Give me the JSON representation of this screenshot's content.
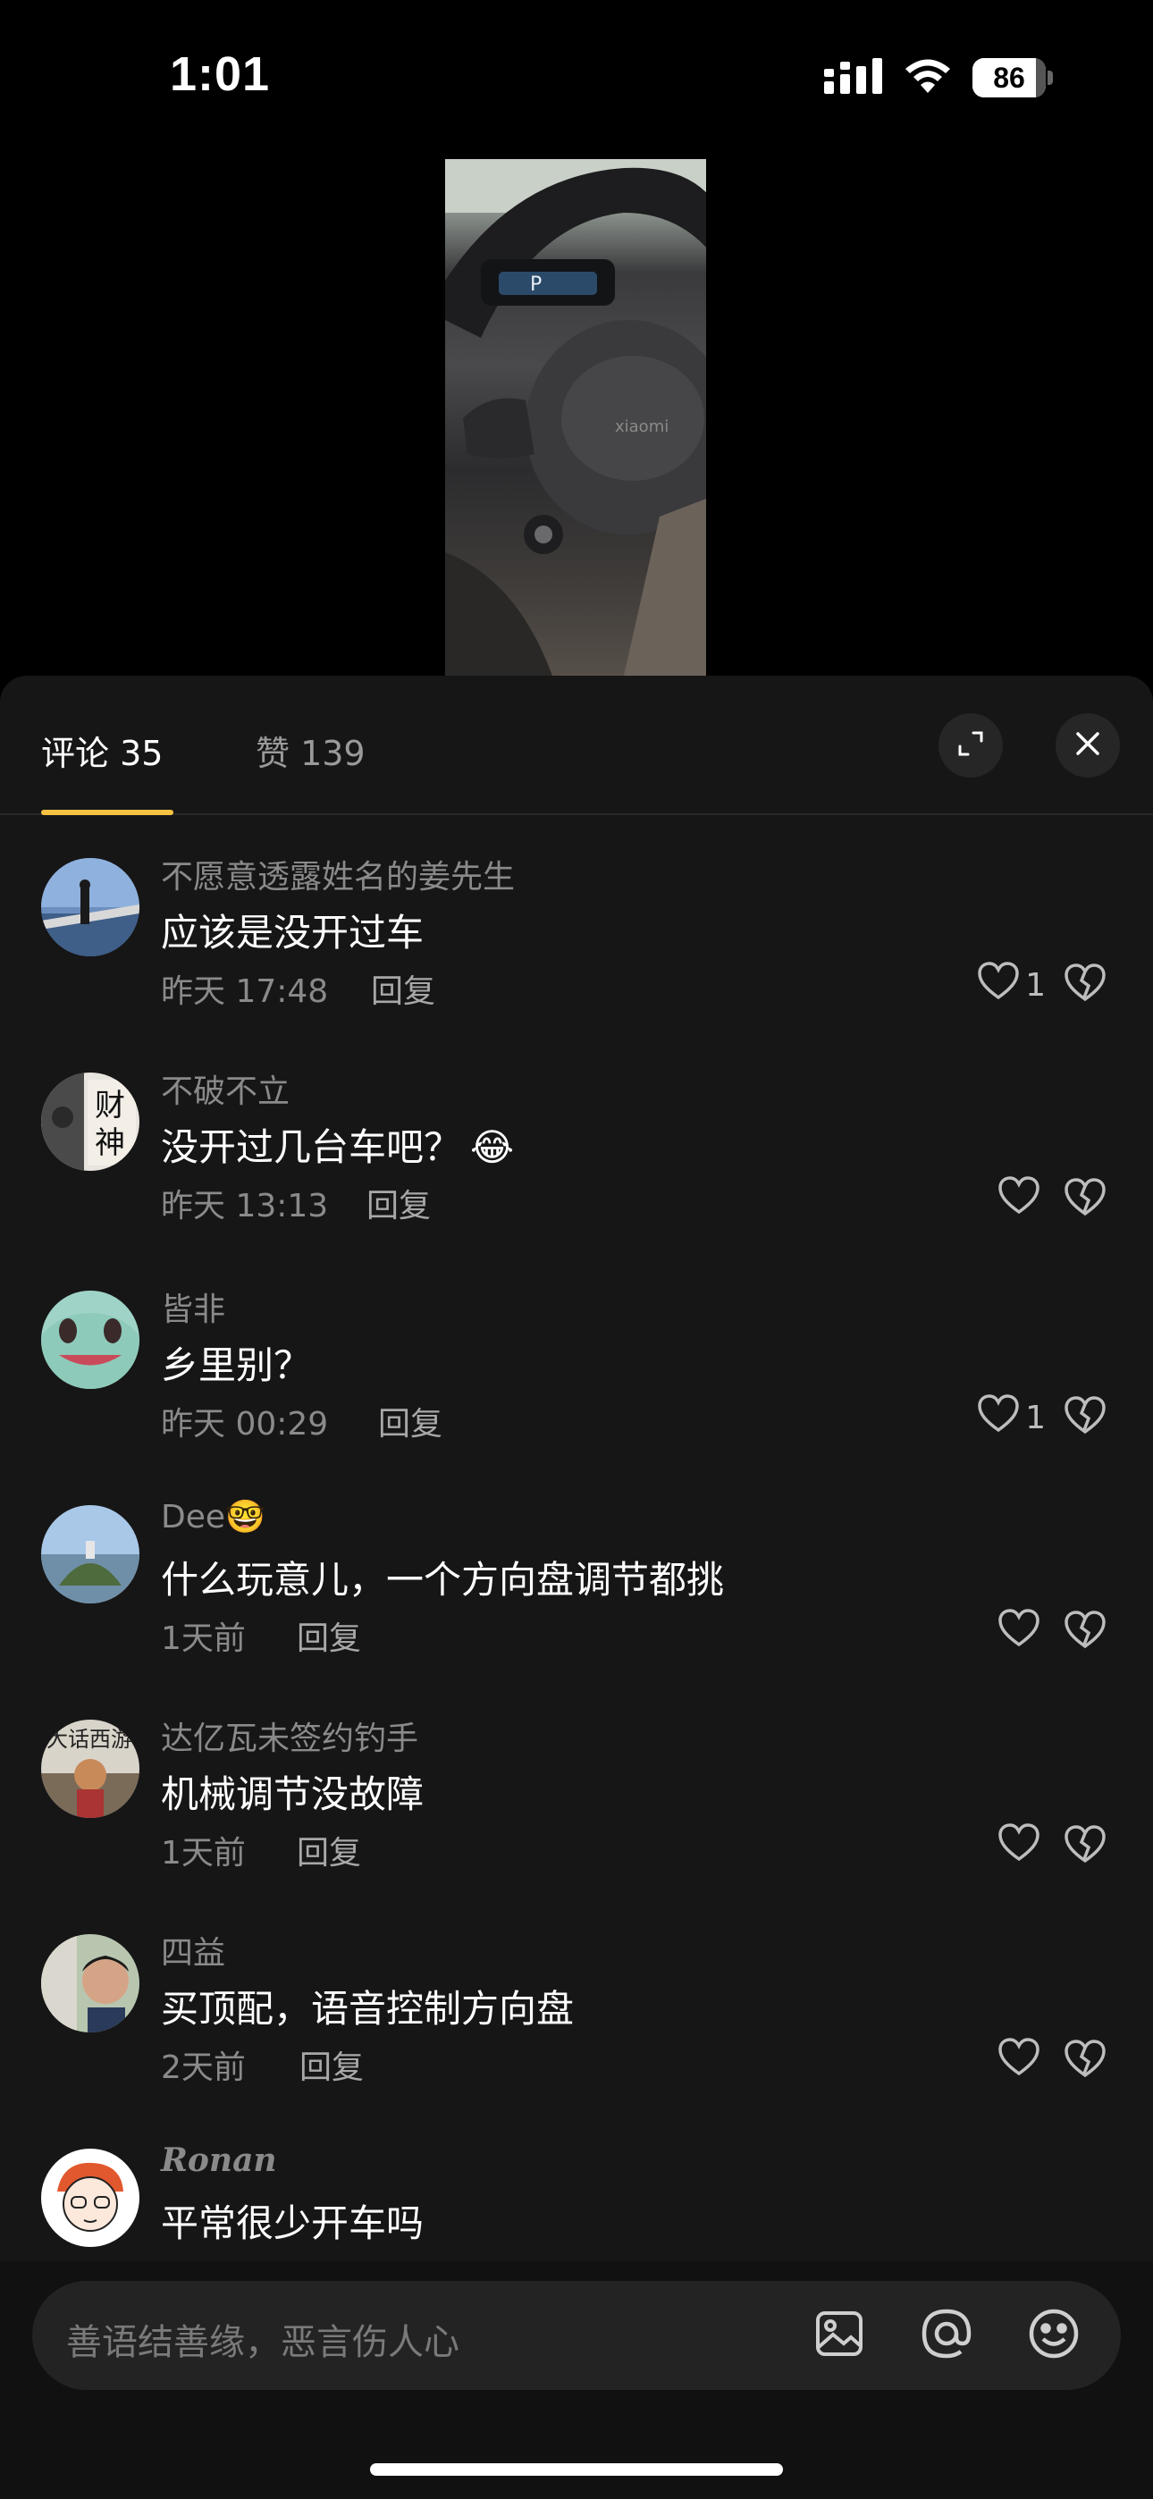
{
  "status_bar": {
    "time": "1:01",
    "battery_level": "86",
    "battery_fraction": 0.86,
    "icons": [
      "cellular-signal-icon",
      "wifi-icon",
      "battery-icon"
    ]
  },
  "video": {
    "description_icon": "video-thumbnail"
  },
  "sheet": {
    "tabs": [
      {
        "label": "评论 35",
        "active": true
      },
      {
        "label": "赞 139",
        "active": false
      }
    ],
    "accent": "#f6c342",
    "buttons": [
      "expand-icon",
      "close-icon"
    ]
  },
  "comments": [
    {
      "name": "不愿意透露姓名的姜先生",
      "text": "应该是没开过车",
      "time": "昨天 17:48",
      "reply": "回复",
      "likes": "1"
    },
    {
      "name": "不破不立",
      "text": "没开过几台车吧？",
      "emoji": "😂",
      "time": "昨天 13:13",
      "reply": "回复",
      "likes": ""
    },
    {
      "name": "皆非",
      "text": "乡里别？",
      "time": "昨天 00:29",
      "reply": "回复",
      "likes": "1"
    },
    {
      "name": "Dee",
      "name_emoji": "🤓",
      "text": "什么玩意儿，一个方向盘调节都挑",
      "time": "1天前",
      "reply": "回复",
      "likes": ""
    },
    {
      "name": "达亿瓦未签约钓手",
      "text": "机械调节没故障",
      "time": "1天前",
      "reply": "回复",
      "likes": ""
    },
    {
      "name": "四益",
      "text": "买顶配，语音控制方向盘",
      "time": "2天前",
      "reply": "回复",
      "likes": ""
    },
    {
      "name": "Ronan",
      "text": "平常很少开车吗",
      "time": "",
      "reply": "",
      "likes": ""
    }
  ],
  "input": {
    "placeholder": "善语结善缘，恶言伤人心",
    "icons": [
      "image-icon",
      "at-icon",
      "emoji-icon"
    ]
  }
}
